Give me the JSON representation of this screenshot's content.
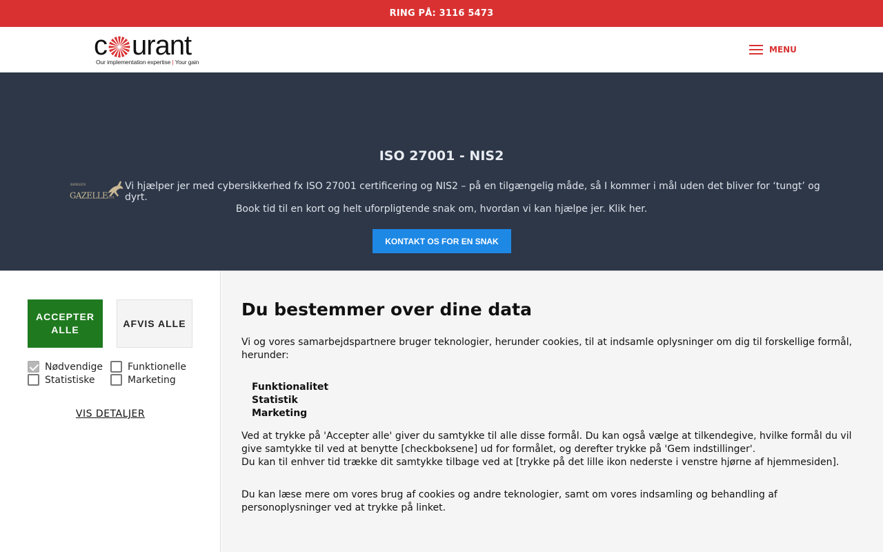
{
  "topbar": {
    "phone_text": "RING PÅ: 3116 5473"
  },
  "header": {
    "logo": {
      "word_before": "c",
      "word_after": "urant",
      "tagline_left": "Our implementation expertise",
      "tagline_sep": "|",
      "tagline_right": "Your gain"
    },
    "menu_label": "MENU"
  },
  "hero": {
    "title": "ISO 27001 - NIS2",
    "badge": {
      "top": "BØRSEN",
      "name": "GAZELLE",
      "year": "2024"
    },
    "line1": "Vi hjælper jer med cybersikkerhed fx ISO 27001 certificering og NIS2 – på en tilgængelig måde, så I kommer i mål uden det bliver for ‘tungt’ og dyrt.",
    "line2": "Book tid til en kort og helt uforpligtende snak om, hvordan vi kan hjælpe jer. Klik her.",
    "cta": "KONTAKT OS FOR EN SNAK"
  },
  "consent": {
    "accept_label": "ACCEPTER ALLE",
    "reject_label": "AFVIS ALLE",
    "checkboxes": [
      {
        "label": "Nødvendige",
        "checked": true
      },
      {
        "label": "Funktionelle",
        "checked": false
      },
      {
        "label": "Statistiske",
        "checked": false
      },
      {
        "label": "Marketing",
        "checked": false
      }
    ],
    "details_link": "VIS DETALJER",
    "heading": "Du bestemmer over dine data",
    "intro": "Vi og vores samarbejdspartnere bruger teknologier, herunder cookies, til at indsamle oplysninger om dig til forskellige formål, herunder:",
    "purposes": [
      "Funktionalitet",
      "Statistik",
      "Marketing"
    ],
    "body1": "Ved at trykke på 'Accepter alle' giver du samtykke til alle disse formål. Du kan også vælge at tilkendegive, hvilke formål du vil give samtykke til ved at benytte [checkboksene] ud for formålet, og derefter trykke på 'Gem indstillinger'.",
    "body2": "Du kan til enhver tid trække dit samtykke tilbage ved at [trykke på det lille ikon nederste i venstre hjørne af hjemmesiden].",
    "body3": "Du kan læse mere om vores brug af cookies og andre teknologier, samt om vores indsamling og behandling af personoplysninger ved at trykke på linket."
  },
  "colors": {
    "brand_red": "#d93131",
    "hero_bg": "#2d3748",
    "cta_blue": "#1e88e5",
    "accept_green": "#1f7a1f"
  }
}
